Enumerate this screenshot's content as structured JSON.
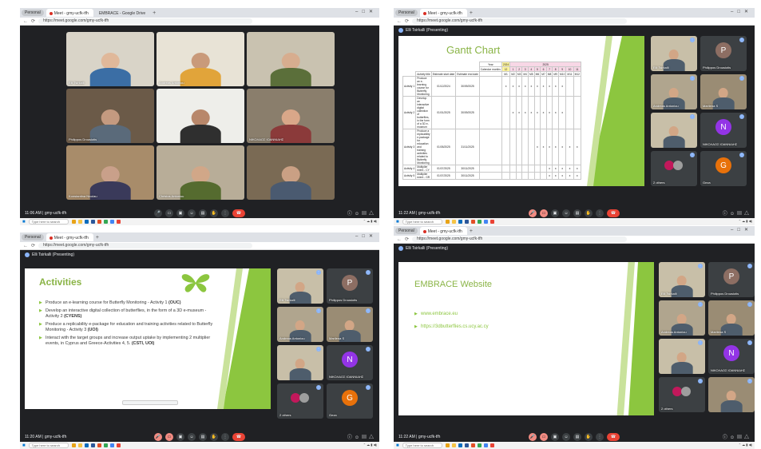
{
  "common": {
    "profile_label": "Personal",
    "url": "https://meet.google.com/gmy-ucfk-tfh",
    "meeting_code": "gmy-ucfk-tfh",
    "search_placeholder": "Type here to search",
    "presenter": "Elli Tsirkalli (Presenting)"
  },
  "colors": {
    "meet_bg": "#202124",
    "hangup": "#ea4335",
    "slide_green": "#8cc63f",
    "slide_title_green": "#8ab446"
  },
  "shot1": {
    "tab1": "Meet - gmy-ucfk-tfh",
    "tab2": "EMBRACE - Google Drive",
    "time": "11:06 AM",
    "tiles": [
      {
        "name": "Elli Tsirkalli"
      },
      {
        "name": "Andreas Antoniou"
      },
      {
        "name": ""
      },
      {
        "name": "Philippos Drousiotis"
      },
      {
        "name": ""
      },
      {
        "name": "ΝΙΚΟΛΑΟΣ ΙΟΑΝΝΙΔΗΣ"
      },
      {
        "name": "Konstantina Nicolau"
      },
      {
        "name": "Christos Antoniou"
      },
      {
        "name": ""
      }
    ]
  },
  "shot2": {
    "tab1": "Meet - gmy-ucfk-tfh",
    "time": "11:22 AM",
    "slide_title": "Gantt Chart",
    "gantt": {
      "year_label": "Year",
      "year_2024": "2024",
      "year_2025": "2025",
      "calendar_months": "Calendar months",
      "month_headers": [
        "12",
        "1",
        "2",
        "3",
        "4",
        "5",
        "6",
        "7",
        "8",
        "9",
        "10",
        "11"
      ],
      "col_est_start": "Estimate start date",
      "col_est_end": "Estimate end date",
      "col_title": "Activity title",
      "m_headers": [
        "M1",
        "M2",
        "M3",
        "M4",
        "M5",
        "M6",
        "M7",
        "M8",
        "M9",
        "M10",
        "M11",
        "M12"
      ],
      "rows": [
        {
          "id": "Activity 1",
          "title": "Produce an e-learning course for Butterfly Monitoring",
          "start": "01/12/2024",
          "end": "30/09/2025",
          "marks": [
            1,
            1,
            1,
            1,
            1,
            1,
            1,
            1,
            1,
            1,
            0,
            0
          ]
        },
        {
          "id": "Activity 2",
          "title": "Develop an interactive digital collection of butterflies, in the form of a 3D e-museum",
          "start": "01/01/2025",
          "end": "30/09/2025",
          "marks": [
            0,
            1,
            1,
            1,
            1,
            1,
            1,
            1,
            1,
            1,
            0,
            0
          ]
        },
        {
          "id": "Activity 3",
          "title": "Produce a replicability e-package for education and training activities related to Butterfly Monitoring",
          "start": "01/05/2025",
          "end": "31/11/2025",
          "marks": [
            0,
            0,
            0,
            0,
            0,
            1,
            1,
            1,
            1,
            1,
            1,
            1
          ]
        },
        {
          "id": "Activity 4",
          "title": "Multiplier event - CY",
          "start": "01/07/2025",
          "end": "30/11/2025",
          "marks": [
            0,
            0,
            0,
            0,
            0,
            0,
            0,
            1,
            1,
            1,
            1,
            1
          ]
        },
        {
          "id": "Activity 5",
          "title": "Multiplier event - GR",
          "start": "01/07/2025",
          "end": "30/11/2025",
          "marks": [
            0,
            0,
            0,
            0,
            0,
            0,
            0,
            1,
            1,
            1,
            1,
            1
          ]
        }
      ]
    },
    "side": [
      {
        "name": "Elli Tsirkalli"
      },
      {
        "name": "Philippos Drousiotis",
        "initial": "P",
        "color": "#8d6e63"
      },
      {
        "name": "Andreas Antoniou"
      },
      {
        "name": "Marilena S"
      },
      {
        "name": ""
      },
      {
        "name": "ΝΙΚΟΛΑΟΣ ΙΟΑΝΝΙΔΗΣ",
        "initial": "N",
        "color": "#9334e6"
      },
      {
        "name": "2 others"
      },
      {
        "name": "Geza",
        "initial": "G",
        "color": "#e8710a"
      }
    ]
  },
  "shot3": {
    "tab1": "Meet - gmy-ucfk-tfh",
    "time": "11:20 AM",
    "slide_title": "Activities",
    "bullets": [
      {
        "text": "Produce an e-learning course for Butterfly Monitoring - Activity 1",
        "bold": "(OUC)"
      },
      {
        "text": "Develop an interactive digital collection of butterflies, in the form of a 3D e-museum - Activity 2",
        "bold": "(CYENS)"
      },
      {
        "text": "Produce a replicability e-package for education and training activities related to Butterfly Monitoring - Activity 3",
        "bold": "(UOI)"
      },
      {
        "text": "Interact with the target groups and increase output uptake by implementing 2 multiplier events, in Cyprus and Greece-Activities 4, 5.",
        "bold": "(CSTI, UOI)"
      }
    ],
    "side": [
      {
        "name": "Elli Tsirkalli"
      },
      {
        "name": "Philippos Drousiotis",
        "initial": "P",
        "color": "#8d6e63"
      },
      {
        "name": "Andreas Antoniou"
      },
      {
        "name": "Marilena S"
      },
      {
        "name": ""
      },
      {
        "name": "ΝΙΚΟΛΑΟΣ ΙΟΑΝΝΙΔΗΣ",
        "initial": "N",
        "color": "#9334e6"
      },
      {
        "name": "2 others"
      },
      {
        "name": "Geza",
        "initial": "G",
        "color": "#e8710a"
      }
    ]
  },
  "shot4": {
    "tab1": "Meet - gmy-ucfk-tfh",
    "time": "11:22 AM",
    "slide_title": "EMBRACE Website",
    "links": [
      "www.embrace.eu",
      "https://3dbutterflies.cs.ucy.ac.cy"
    ],
    "side": [
      {
        "name": "Elli Tsirkalli"
      },
      {
        "name": "Philippos Drousiotis",
        "initial": "P",
        "color": "#8d6e63"
      },
      {
        "name": "Andreas Antoniou"
      },
      {
        "name": "Marilena S"
      },
      {
        "name": ""
      },
      {
        "name": "ΝΙΚΟΛΑΟΣ ΙΟΑΝΝΙΔΗΣ",
        "initial": "N",
        "color": "#9334e6"
      },
      {
        "name": "2 others"
      },
      {
        "name": ""
      }
    ]
  }
}
